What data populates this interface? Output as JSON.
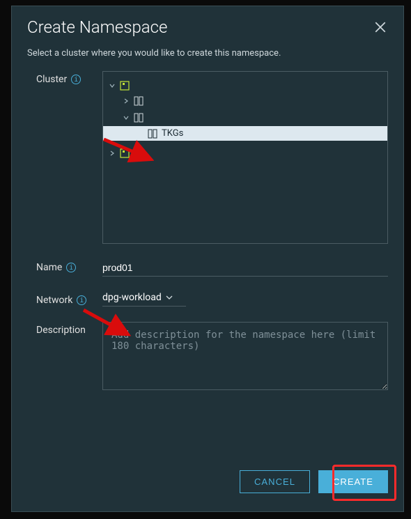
{
  "modal": {
    "title": "Create Namespace",
    "subtitle": "Select a cluster where you would like to create this namespace."
  },
  "labels": {
    "cluster": "Cluster",
    "name": "Name",
    "network": "Network",
    "description": "Description"
  },
  "tree": {
    "root1_label": "",
    "child1_label": "",
    "child2_label": "",
    "selected_label": "TKGs",
    "root2_label": ""
  },
  "form": {
    "name_value": "prod01",
    "network_value": "dpg-workload",
    "description_placeholder": "Add description for the namespace here (limit 180 characters)"
  },
  "buttons": {
    "cancel": "CANCEL",
    "create": "CREATE"
  }
}
